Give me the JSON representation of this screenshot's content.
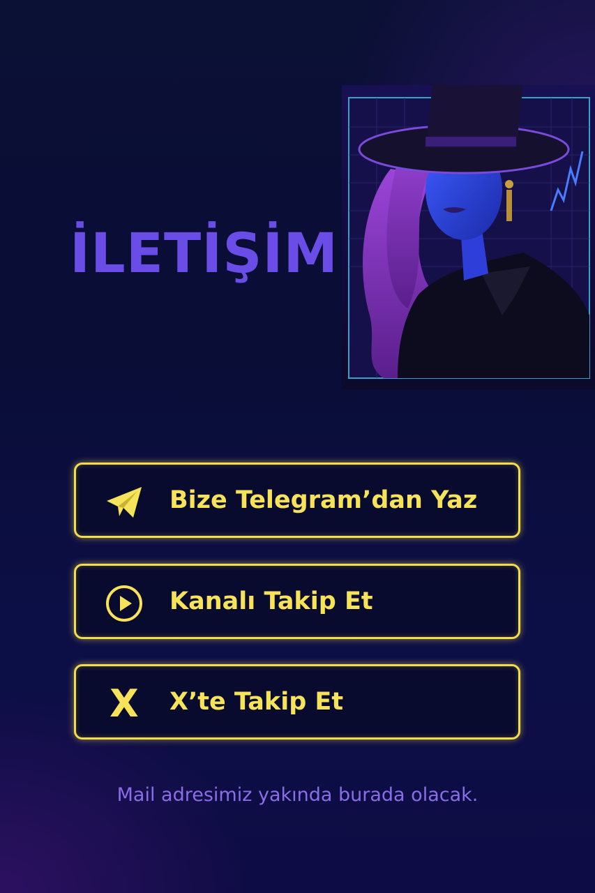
{
  "header": {
    "title": "İLETİŞİM"
  },
  "hero_image": {
    "description_icon": "neon-woman-portrait-illustration"
  },
  "buttons": [
    {
      "label": "Bize Telegram’dan Yaz",
      "icon": "telegram-paper-plane-icon"
    },
    {
      "label": "Kanalı Takip Et",
      "icon": "play-circle-icon"
    },
    {
      "label": "X’te Takip Et",
      "icon": "x-logo-icon",
      "glyph": "X"
    }
  ],
  "footer": {
    "note": "Mail adresimiz yakında burada olacak."
  },
  "colors": {
    "title": "#6a4de6",
    "button_border": "#f4dd4a",
    "button_text": "#f6e35a",
    "footnote": "#8a6ee6",
    "background": "#0b1035"
  }
}
